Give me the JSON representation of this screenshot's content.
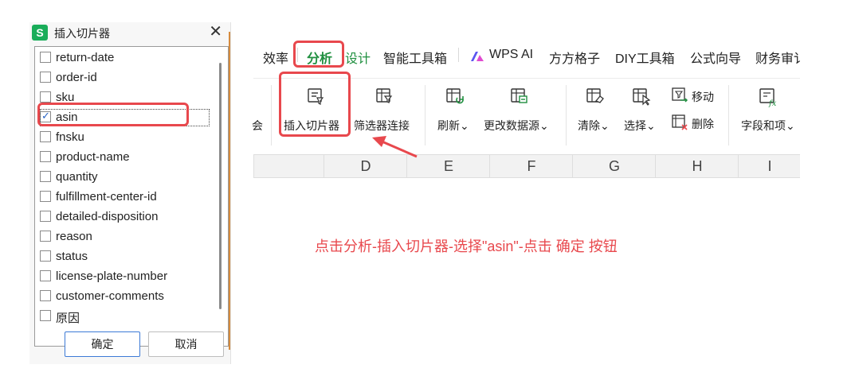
{
  "dialog": {
    "badge": "S",
    "title": "插入切片器",
    "close": "✕",
    "fields": [
      {
        "label": "return-date",
        "checked": false
      },
      {
        "label": "order-id",
        "checked": false
      },
      {
        "label": "sku",
        "checked": false
      },
      {
        "label": "asin",
        "checked": true
      },
      {
        "label": "fnsku",
        "checked": false
      },
      {
        "label": "product-name",
        "checked": false
      },
      {
        "label": "quantity",
        "checked": false
      },
      {
        "label": "fulfillment-center-id",
        "checked": false
      },
      {
        "label": "detailed-disposition",
        "checked": false
      },
      {
        "label": "reason",
        "checked": false
      },
      {
        "label": "status",
        "checked": false
      },
      {
        "label": "license-plate-number",
        "checked": false
      },
      {
        "label": "customer-comments",
        "checked": false
      },
      {
        "label": "原因",
        "checked": false
      }
    ],
    "ok_label": "确定",
    "cancel_label": "取消"
  },
  "ribbon": {
    "tabs": {
      "efficiency": "效率",
      "analysis": "分析",
      "design": "设计",
      "smart_toolbox": "智能工具箱",
      "wps_ai": "WPS AI",
      "fangfang": "方方格子",
      "diy": "DIY工具箱",
      "formula": "公式向导",
      "finance": "财务审讠"
    },
    "tools": {
      "partial": "会",
      "insert_slicer": "插入切片器",
      "filter_connection": "筛选器连接",
      "refresh": "刷新",
      "change_source": "更改数据源",
      "clear": "清除",
      "select": "选择",
      "move": "移动",
      "delete": "删除",
      "fields_items": "字段和项"
    },
    "dropdown_glyph": "⌄",
    "columns": [
      "D",
      "E",
      "F",
      "G",
      "H",
      "I"
    ]
  },
  "instruction": "点击分析-插入切片器-选择\"asin\"-点击 确定 按钮",
  "colors": {
    "highlight": "#e8484d",
    "active_tab": "#1f8f3f",
    "badge": "#1aad5a",
    "checkmark": "#2a64c5"
  }
}
